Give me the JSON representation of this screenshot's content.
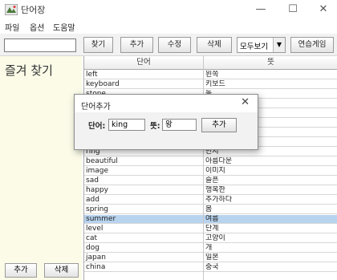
{
  "window": {
    "title": "단어장",
    "minimize": "—",
    "maximize": "☐",
    "close": "✕"
  },
  "menu": [
    "파일",
    "옵션",
    "도움말"
  ],
  "toolbar": {
    "search_value": "",
    "find": "찾기",
    "add": "추가",
    "edit": "수정",
    "delete": "삭제",
    "view_mode": "모두보기",
    "practice": "연습게임"
  },
  "favorites": {
    "title": "즐겨 찾기",
    "add": "추가",
    "delete": "삭제"
  },
  "table": {
    "headers": [
      "단어",
      "뜻"
    ],
    "rows": [
      [
        "left",
        "왼쪽"
      ],
      [
        "keyboard",
        "키보드"
      ],
      [
        "stone",
        "돌"
      ],
      [
        "",
        ""
      ],
      [
        "",
        ""
      ],
      [
        "",
        ""
      ],
      [
        "",
        ""
      ],
      [
        "",
        ""
      ],
      [
        "ring",
        "반지"
      ],
      [
        "beautiful",
        "아름다운"
      ],
      [
        "image",
        "이미지"
      ],
      [
        "sad",
        "슬픈"
      ],
      [
        "happy",
        "행복한"
      ],
      [
        "add",
        "추가하다"
      ],
      [
        "spring",
        "봄"
      ],
      [
        "summer",
        "여름"
      ],
      [
        "level",
        "단계"
      ],
      [
        "cat",
        "고양이"
      ],
      [
        "dog",
        "개"
      ],
      [
        "japan",
        "일본"
      ],
      [
        "china",
        "중국"
      ]
    ],
    "selected_index": 15
  },
  "dialog": {
    "title": "단어추가",
    "close": "✕",
    "word_label": "단어:",
    "word_value": "king",
    "meaning_label": "뜻:",
    "meaning_value": "왕",
    "add_button": "추가"
  },
  "colors": {
    "selected_row": "#b7d3ee",
    "favorites_bg": "#fbfbe8"
  }
}
